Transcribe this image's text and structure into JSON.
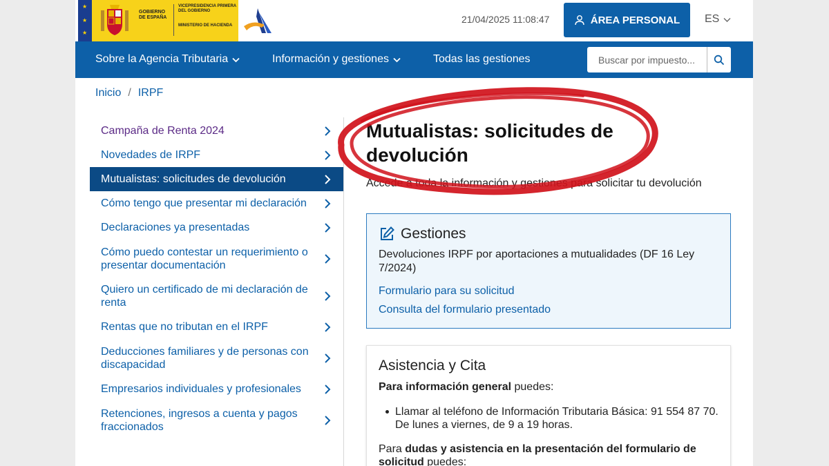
{
  "header": {
    "gobierno_text": "GOBIERNO DE ESPAÑA",
    "vicepresidencia_text": "VICEPRESIDENCIA PRIMERA DEL GOBIERNO",
    "ministerio_text": "MINISTERIO DE HACIENDA",
    "datetime": "21/04/2025 11:08:47",
    "area_personal_label": "ÁREA PERSONAL",
    "language": "ES",
    "brand_color": "#0d60a8"
  },
  "nav": {
    "items": [
      {
        "label": "Sobre la Agencia Tributaria",
        "has_dropdown": true
      },
      {
        "label": "Información y gestiones",
        "has_dropdown": true
      },
      {
        "label": "Todas las gestiones",
        "has_dropdown": false
      }
    ],
    "search_placeholder": "Buscar por impuesto..."
  },
  "breadcrumb": [
    "Inicio",
    "IRPF"
  ],
  "sidebar": {
    "items": [
      {
        "label": "Campaña de Renta 2024",
        "state": "visited"
      },
      {
        "label": "Novedades de IRPF",
        "state": "normal"
      },
      {
        "label": "Mutualistas: solicitudes de devolución",
        "state": "active"
      },
      {
        "label": "Cómo tengo que presentar mi declaración",
        "state": "normal"
      },
      {
        "label": "Declaraciones ya presentadas",
        "state": "normal"
      },
      {
        "label": "Cómo puedo contestar un requerimiento o presentar documentación",
        "state": "normal"
      },
      {
        "label": "Quiero un certificado de mi declaración de renta",
        "state": "normal"
      },
      {
        "label": "Rentas que no tributan en el IRPF",
        "state": "normal"
      },
      {
        "label": "Deducciones familiares y de personas con discapacidad",
        "state": "normal"
      },
      {
        "label": "Empresarios individuales y profesionales",
        "state": "normal"
      },
      {
        "label": "Retenciones, ingresos a cuenta y pagos fraccionados",
        "state": "normal"
      }
    ]
  },
  "main": {
    "title": "Mutualistas: solicitudes de devolución",
    "subtitle": "Accede a toda la información y gestiones para solicitar tu devolución",
    "gestiones": {
      "heading": "Gestiones",
      "description": "Devoluciones IRPF por aportaciones a mutualidades (DF 16 Ley 7/2024)",
      "links": [
        "Formulario para su solicitud",
        "Consulta del formulario presentado"
      ]
    },
    "asistencia": {
      "heading": "Asistencia y Cita",
      "p1_bold": "Para información general",
      "p1_rest": " puedes:",
      "bullet": "Llamar al teléfono de Información Tributaria Básica: 91 554 87 70. De lunes a viernes, de 9 a 19 horas.",
      "p2_start": "Para ",
      "p2_bold": "dudas y asistencia en la presentación del formulario de solicitud",
      "p2_rest": " puedes:"
    }
  },
  "annotation_color": "#d0121b"
}
